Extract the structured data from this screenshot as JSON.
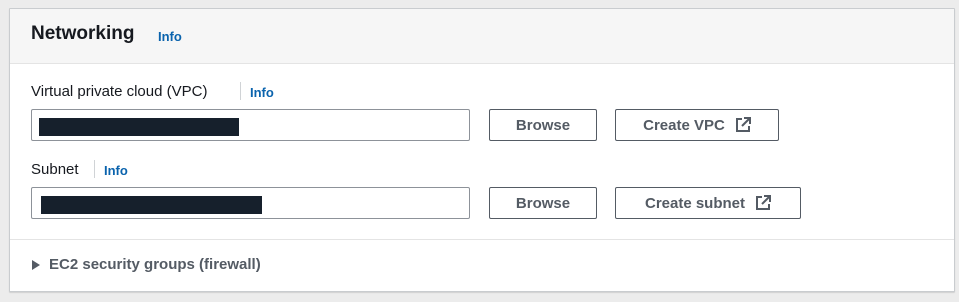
{
  "networking": {
    "title": "Networking",
    "info_label": "Info"
  },
  "vpc": {
    "label": "Virtual private cloud (VPC)",
    "info_label": "Info",
    "browse_label": "Browse",
    "create_label": "Create VPC",
    "create_icon": "external-link-icon"
  },
  "subnet": {
    "label": "Subnet",
    "info_label": "Info",
    "browse_label": "Browse",
    "create_label": "Create subnet",
    "create_icon": "external-link-icon"
  },
  "security_groups": {
    "label": "EC2 security groups (firewall)",
    "expanded": false
  },
  "colors": {
    "link": "#0a63ad",
    "button_text": "#545b64",
    "redaction": "#16202c"
  }
}
